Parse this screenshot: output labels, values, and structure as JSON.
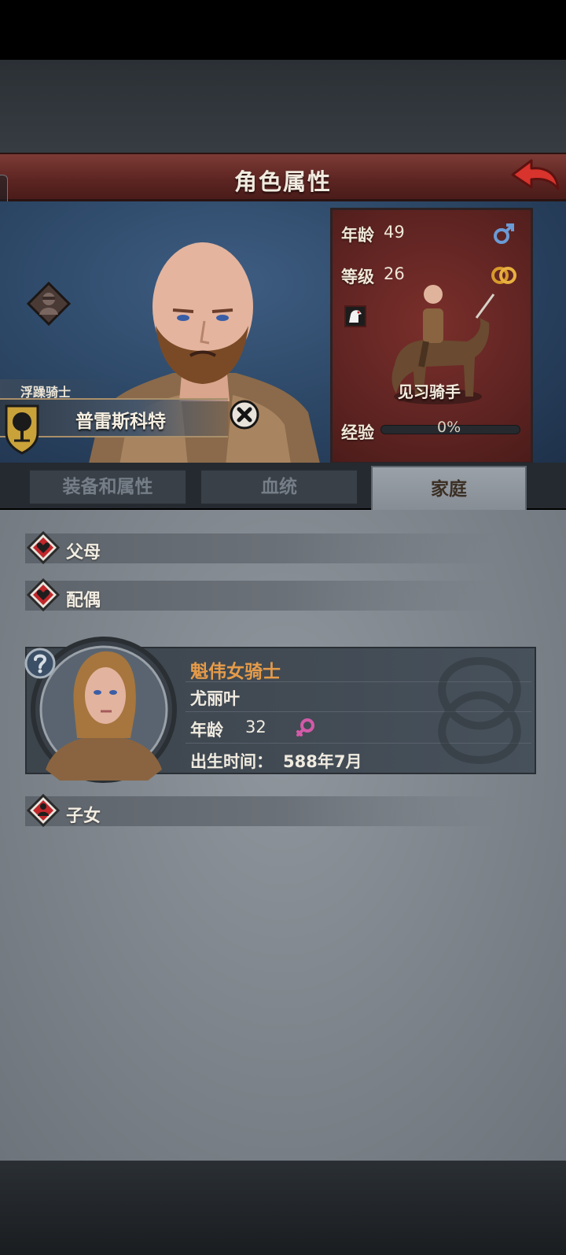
{
  "header": {
    "title": "角色属性"
  },
  "hero": {
    "subtitle": "浮躁骑士",
    "name": "普雷斯科特"
  },
  "stats": {
    "age_label": "年龄",
    "age_value": "49",
    "level_label": "等级",
    "level_value": "26",
    "rank": "见习骑手",
    "exp_label": "经验",
    "exp_value": "0%",
    "exp_fraction": 0,
    "gender_icon": "male-icon",
    "marriage_icon": "wedding-rings-icon"
  },
  "tabs": [
    {
      "label": "装备和属性",
      "active": false
    },
    {
      "label": "血统",
      "active": false
    },
    {
      "label": "家庭",
      "active": true
    }
  ],
  "family": {
    "parents_label": "父母",
    "spouse_label": "配偶",
    "children_label": "子女",
    "spouse": {
      "title": "魁伟女骑士",
      "name": "尤丽叶",
      "age_label": "年龄",
      "age_value": "32",
      "birth_label": "出生时间：",
      "birth_value": "588年7月",
      "gender_icon": "female-icon"
    }
  },
  "colors": {
    "title_bar": "#5b2421",
    "stats_panel": "#6a2a27",
    "accent_orange": "#e59b49",
    "male_blue": "#6a9bd6",
    "female_pink": "#d35aa8",
    "heart_red": "#c0262a"
  }
}
